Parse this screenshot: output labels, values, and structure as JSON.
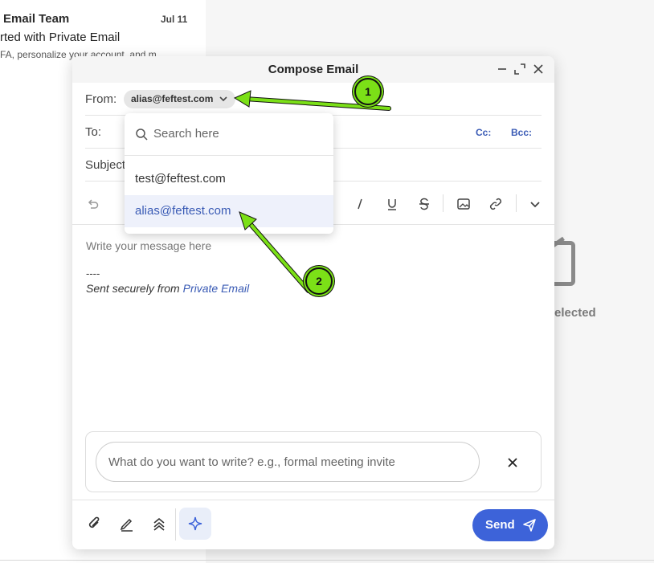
{
  "background": {
    "sender": "Email Team",
    "date": "Jul 11",
    "subject": "rted with Private Email",
    "preview": "FA, personalize your account, and m",
    "empty_state": "elected"
  },
  "compose": {
    "title": "Compose Email",
    "from_label": "From:",
    "from_value": "alias@feftest.com",
    "to_label": "To:",
    "cc_label": "Cc:",
    "bcc_label": "Bcc:",
    "subject_label": "Subject",
    "body_placeholder": "Write your message here",
    "signature_dash": "----",
    "signature_prefix": "Sent securely from ",
    "signature_link": "Private Email",
    "ai_placeholder": "What do you want to write? e.g., formal meeting invite",
    "send_label": "Send"
  },
  "from_dropdown": {
    "search_placeholder": "Search here",
    "options": [
      "test@feftest.com",
      "alias@feftest.com"
    ],
    "highlighted": "alias@feftest.com"
  },
  "annotations": [
    {
      "label": "1"
    },
    {
      "label": "2"
    }
  ],
  "colors": {
    "accent": "#3d63d9",
    "link": "#3a5bb5",
    "annotation": "#7be017"
  }
}
